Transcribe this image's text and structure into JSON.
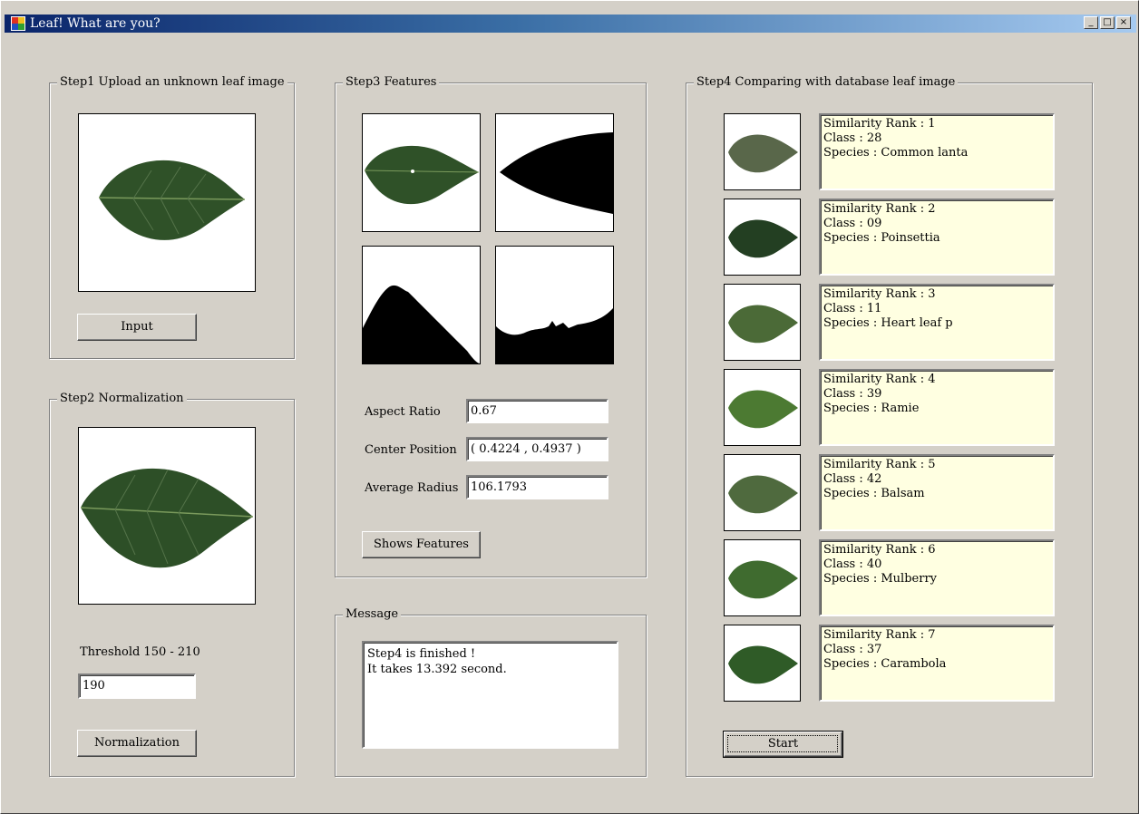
{
  "window": {
    "title": "Leaf! What are you?",
    "minimize_glyph": "_",
    "maximize_glyph": "□",
    "close_glyph": "×"
  },
  "step1": {
    "title": "Step1 Upload an unknown leaf image",
    "input_label": "Input"
  },
  "step2": {
    "title": "Step2 Normalization",
    "threshold_label": "Threshold  150 - 210",
    "threshold_value": "190",
    "normalize_label": "Normalization"
  },
  "step3": {
    "title": "Step3 Features",
    "aspect_label": "Aspect Ratio",
    "aspect_value": "0.67",
    "center_label": "Center Position",
    "center_value": "( 0.4224 , 0.4937 )",
    "radius_label": "Average Radius",
    "radius_value": "106.1793",
    "shows_label": "Shows Features"
  },
  "message": {
    "title": "Message",
    "line1": "Step4 is finished !",
    "line2": "It takes 13.392 second."
  },
  "step4": {
    "title": "Step4 Comparing with database leaf image",
    "start_label": "Start",
    "results": [
      {
        "rank": "Similarity Rank  : 1",
        "class": "Class : 28",
        "species": "Species : Common lanta",
        "color": "#59674a"
      },
      {
        "rank": "Similarity Rank  : 2",
        "class": "Class : 09",
        "species": "Species : Poinsettia",
        "color": "#233f22"
      },
      {
        "rank": "Similarity Rank  : 3",
        "class": "Class : 11",
        "species": "Species : Heart leaf p",
        "color": "#4b6a37"
      },
      {
        "rank": "Similarity Rank  : 4",
        "class": "Class : 39",
        "species": "Species : Ramie",
        "color": "#4c7a32"
      },
      {
        "rank": "Similarity Rank  : 5",
        "class": "Class : 42",
        "species": "Species : Balsam",
        "color": "#4f6a3e"
      },
      {
        "rank": "Similarity Rank  : 6",
        "class": "Class : 40",
        "species": "Species : Mulberry",
        "color": "#3f6b2f"
      },
      {
        "rank": "Similarity Rank  : 7",
        "class": "Class : 37",
        "species": "Species : Carambola",
        "color": "#2f5b27"
      }
    ]
  },
  "colors": {
    "leaf_main": "#2f5128",
    "leaf_vein": "#7a9a5c",
    "result_bg": "#ffffe1",
    "title_start": "#0a246a",
    "title_end": "#a6caf0"
  }
}
